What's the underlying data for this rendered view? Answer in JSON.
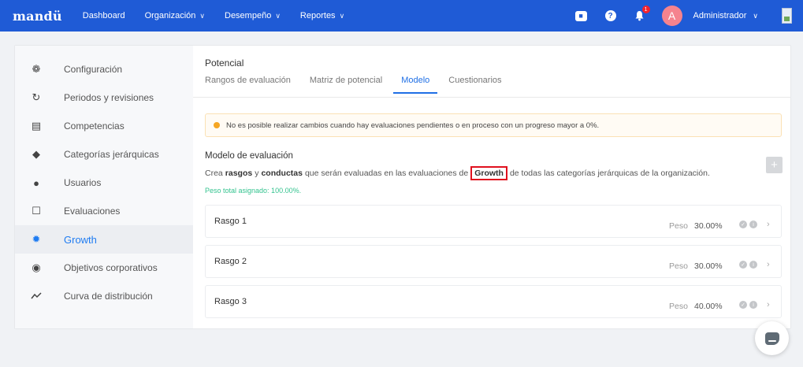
{
  "nav": {
    "brand": "mandü",
    "items": [
      {
        "label": "Dashboard",
        "dropdown": false
      },
      {
        "label": "Organización",
        "dropdown": true
      },
      {
        "label": "Desempeño",
        "dropdown": true
      },
      {
        "label": "Reportes",
        "dropdown": true
      }
    ],
    "notification_count": "1",
    "avatar_letter": "A",
    "user_name": "Administrador"
  },
  "sidebar": {
    "items": [
      {
        "label": "Configuración",
        "icon": "gear-icon"
      },
      {
        "label": "Periodos y revisiones",
        "icon": "refresh-icon"
      },
      {
        "label": "Competencias",
        "icon": "bank-icon"
      },
      {
        "label": "Categorías jerárquicas",
        "icon": "layers-icon"
      },
      {
        "label": "Usuarios",
        "icon": "user-icon"
      },
      {
        "label": "Evaluaciones",
        "icon": "clipboard-icon"
      },
      {
        "label": "Growth",
        "icon": "bulb-icon",
        "active": true
      },
      {
        "label": "Objetivos corporativos",
        "icon": "target-icon"
      },
      {
        "label": "Curva de distribución",
        "icon": "trend-icon"
      }
    ]
  },
  "content": {
    "section_title": "Potencial",
    "tabs": [
      {
        "label": "Rangos de evaluación"
      },
      {
        "label": "Matriz de potencial"
      },
      {
        "label": "Modelo",
        "active": true
      },
      {
        "label": "Cuestionarios"
      }
    ],
    "alert_text": "No es posible realizar cambios cuando hay evaluaciones pendientes o en proceso con un progreso mayor a 0%.",
    "model_title": "Modelo de evaluación",
    "desc": {
      "p1": "Crea",
      "b1": "rasgos",
      "p2": "y",
      "b2": "conductas",
      "p3": "que serán evaluadas en las evaluaciones de",
      "highlight": "Growth",
      "p4": "de todas las categorías jerárquicas de la organización."
    },
    "weight_total": "Peso total asignado: 100.00%.",
    "add_symbol": "+",
    "weight_label": "Peso",
    "rasgos": [
      {
        "name": "Rasgo 1",
        "weight": "30.00%"
      },
      {
        "name": "Rasgo 2",
        "weight": "30.00%"
      },
      {
        "name": "Rasgo 3",
        "weight": "40.00%"
      }
    ]
  },
  "colors": {
    "nav_bg": "#1f5bd6",
    "accent": "#1f7cf2",
    "highlight_border": "#e0101e",
    "success_text": "#34c38f"
  }
}
